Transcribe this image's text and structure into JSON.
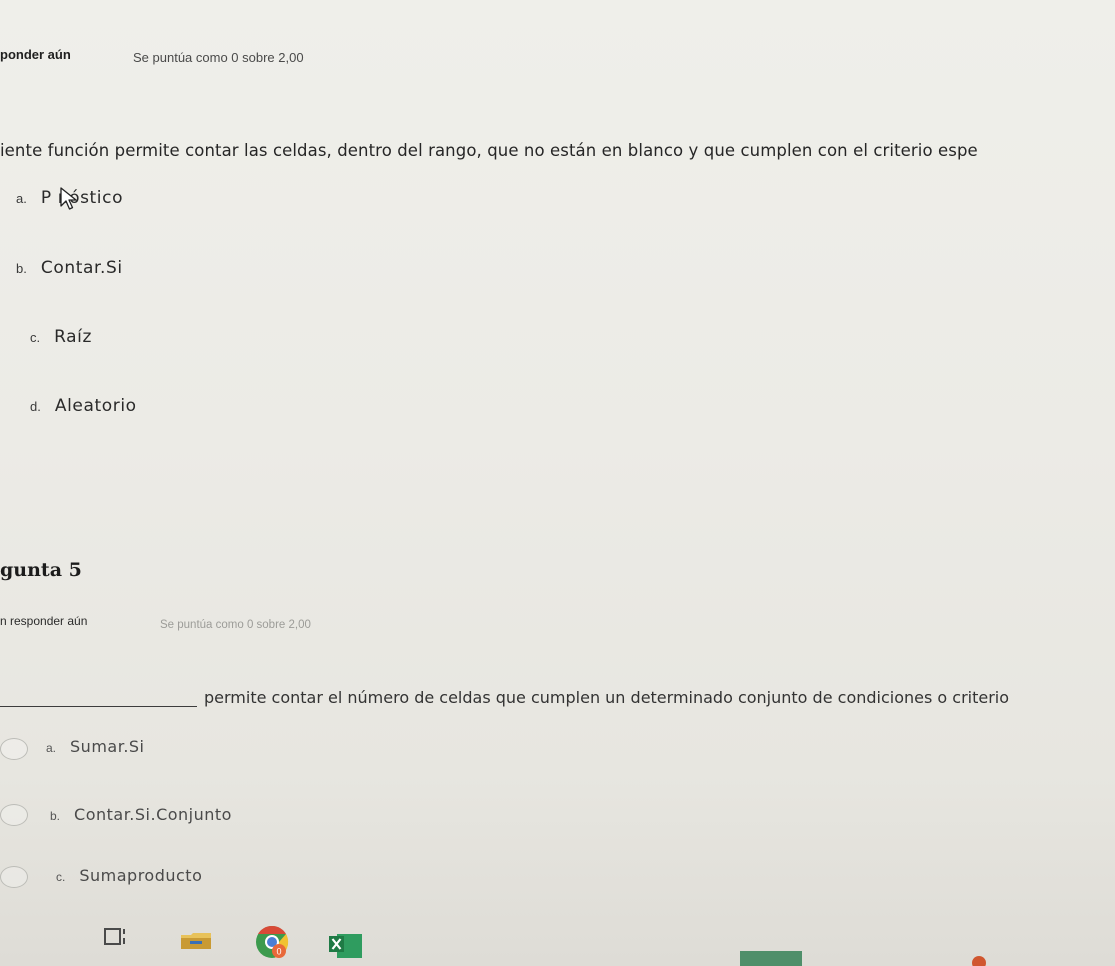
{
  "question4": {
    "status": "ponder aún",
    "grade": "Se puntúa como 0 sobre 2,00",
    "text": "iente función permite contar las celdas, dentro del rango, que no están en blanco y que cumplen con el criterio espe",
    "options": [
      {
        "letter": "a.",
        "label": "P  nóstico"
      },
      {
        "letter": "b.",
        "label": "Contar.Si"
      },
      {
        "letter": "c.",
        "label": "Raíz"
      },
      {
        "letter": "d.",
        "label": "Aleatorio"
      }
    ]
  },
  "question5": {
    "title": "gunta 5",
    "status": "n responder aún",
    "grade": "Se puntúa como 0 sobre 2,00",
    "text": "permite contar el número de celdas que cumplen un determinado conjunto de condiciones o criterio",
    "options": [
      {
        "letter": "a.",
        "label": "Sumar.Si"
      },
      {
        "letter": "b.",
        "label": "Contar.Si.Conjunto"
      },
      {
        "letter": "c.",
        "label": "Sumaproducto"
      }
    ]
  },
  "taskbar": {
    "icons": [
      "task-view-icon",
      "folder-icon",
      "chrome-icon",
      "excel-icon"
    ],
    "chrome_badge": "0",
    "colors": {
      "chrome_red": "#d84a37",
      "chrome_yellow": "#f1c232",
      "chrome_green": "#3c9a4d",
      "excel_green": "#1f7a45",
      "folder_yellow": "#e8c25a"
    }
  }
}
